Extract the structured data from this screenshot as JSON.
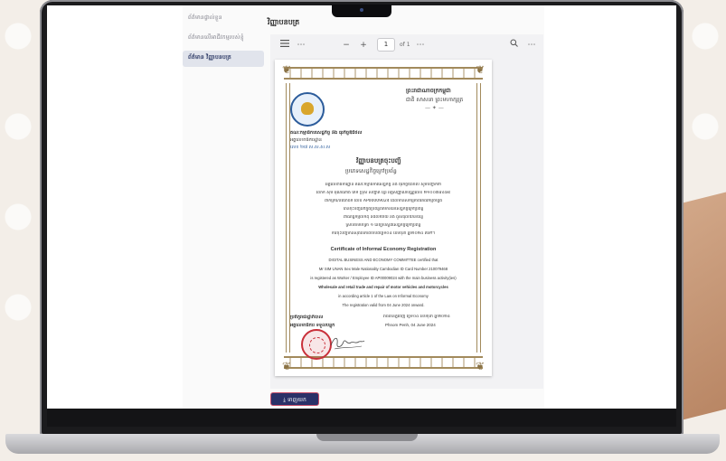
{
  "sidebar": {
    "items": [
      {
        "label": "ព័ត៌មានផ្ទាល់ខ្លួន"
      },
      {
        "label": "ព័ត៌មានលើអាជីវកម្មរបស់ខ្ញុំ"
      },
      {
        "label": "ព័ត៌មាន វិញ្ញាបនបត្រ"
      }
    ]
  },
  "main": {
    "title": "វិញ្ញាបនបត្រ",
    "download_label": "ទាញយក"
  },
  "viewer": {
    "current_page": "1",
    "page_of": "of 1",
    "menu_icon": "hamburger-icon",
    "more_icon": "ellipsis-icon",
    "zoom_out": "−",
    "zoom_in": "+",
    "search_icon": "search-icon"
  },
  "certificate": {
    "kingdom_line1": "ព្រះរាជាណាចក្រកម្ពុជា",
    "kingdom_line2": "ជាតិ សាសនា ព្រះមហាក្សត្រ",
    "committee_kh": "គណៈកម្មាធិការសេដ្ឋកិច្ច និង ធុរកិច្ចឌីជីថល",
    "secretariat_kh": "អគ្គលេខាធិការដ្ឋាន",
    "ref_kh": "លេខ ២៧ ស.ស.ស.ស",
    "title_kh": "វិញ្ញាបនបត្រចុះបញ្ជី",
    "subtitle_kh": "ប្រភេទសេដ្ឋកិច្ចក្រៅប្រព័ន្ធ",
    "body_kh_1": "អគ្គលេខាធិការដ្ឋាន គណៈកម្មាធិការសេដ្ឋកិច្ច និង ធុរកិច្ចឌីជីថល សូមបញ្ជាក់ថា",
    "body_kh_2": "លោក ស៊ីម អ៊ុណណាង់ ភេទ ប្រុស សញ្ជាតិ ខ្មែរ អត្តសញ្ញាណប័ណ្ណលេខ ២១០០៧៩៤៦៨",
    "body_kh_3": "ជាកម្មករ/និយោជិក លេខ AP00009024 ដែលមានសកម្មភាពអាជីវកម្មចម្បង",
    "body_kh_4": "បានចុះបញ្ជីនៅក្នុងប្រព័ន្ធព័ត៌មាននៃសេដ្ឋកិច្ចក្រៅប្រព័ន្ធ",
    "body_kh_5": "ពាណិជ្ជកម្មលក់ដុំ និងលក់រាយ និង ជួសជុលយានយន្ត",
    "body_kh_6": "ស្របតាមមាត្រា ១ នៃច្បាប់ស្តីពីសេដ្ឋកិច្ចក្រៅប្រព័ន្ធ",
    "body_kh_7": "ការចុះបញ្ជីមានសុពលភាពចាប់ពីថ្ងៃទី០៤ ខែមិថុនា ឆ្នាំ២០២៤ តទៅ។",
    "title_en": "Certificate of Informal Economy Registration",
    "committee_en": "DIGITAL BUSINESS AND ECONOMY COMMITTEE certified that",
    "person_en": "Mr SIM UNAN Sex Male Nationality Cambodian ID Card Number 210079468",
    "registered_en": "is registered as Worker / Employee ID AP00009024 with the main business activity(ies)",
    "activity_en": "Wholesale and retail trade and repair of motor vehicles and motorcycles",
    "article_en": "in according article 1 of the Law on Informal Economy",
    "valid_en": "The registration valid from 04 June 2024 onward.",
    "date_kh": "រាជធានីភ្នំពេញ ថ្ងៃទី០៤ ខែមិថុនា ឆ្នាំ២០២៤",
    "date_en": "Phnom Penh, 04 June 2024",
    "signer_kh_1": "ប្រតិភូរាជរដ្ឋាភិបាល",
    "signer_kh_2": "អគ្គលេខាធិការ ទទួលបន្ទុក"
  },
  "colors": {
    "accent": "#2a3168",
    "border_gold": "#a28a5c",
    "stamp_red": "#c9303a"
  }
}
